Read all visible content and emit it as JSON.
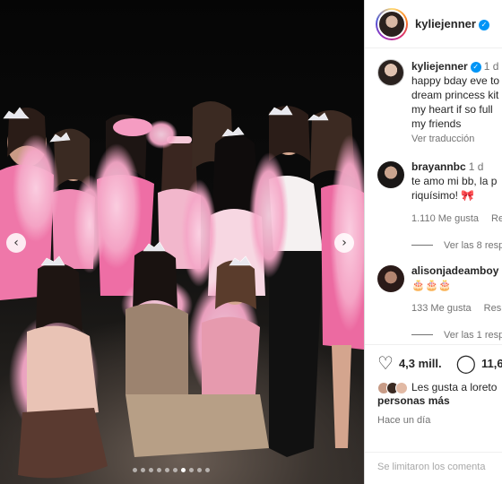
{
  "post": {
    "slide_count": 10,
    "active_slide": 6
  },
  "header": {
    "username": "kyliejenner",
    "verified": true
  },
  "caption": {
    "username": "kyliejenner",
    "time": "1 d",
    "text_lines": [
      "happy bday eve to",
      "dream princess kit",
      "my heart if so full",
      "my friends"
    ],
    "translate_label": "Ver traducción"
  },
  "comments": [
    {
      "username": "brayannbc",
      "time": "1 d",
      "text_lines": [
        "te amo mi bb, la p",
        "riquísimo! 🎀"
      ],
      "likes": "1.110 Me gusta",
      "reply": "Resp",
      "view_replies": "Ver las 8 respu"
    },
    {
      "username": "alisonjadeamboy",
      "time": "",
      "text_lines": [
        "🎂🎂🎂"
      ],
      "likes": "133 Me gusta",
      "reply": "Resp",
      "view_replies": "Ver las 1 respu"
    }
  ],
  "actions": {
    "like_count": "4,3 mill.",
    "comment_count": "11,6"
  },
  "likes_by": {
    "line1": "Les gusta a loreto",
    "line2": "personas más"
  },
  "timestamp": "Hace un día",
  "comments_limited": "Se limitaron los comenta",
  "icons": {
    "prev": "chevron-left-icon",
    "next": "chevron-right-icon",
    "like": "heart-icon",
    "comment": "comment-bubble-icon",
    "verified": "verified-badge-icon"
  },
  "colors": {
    "verified": "#0095f6",
    "pink_boa": "#f4a6c4",
    "pink_dress": "#ef6fa4",
    "muted_text": "#737373"
  }
}
